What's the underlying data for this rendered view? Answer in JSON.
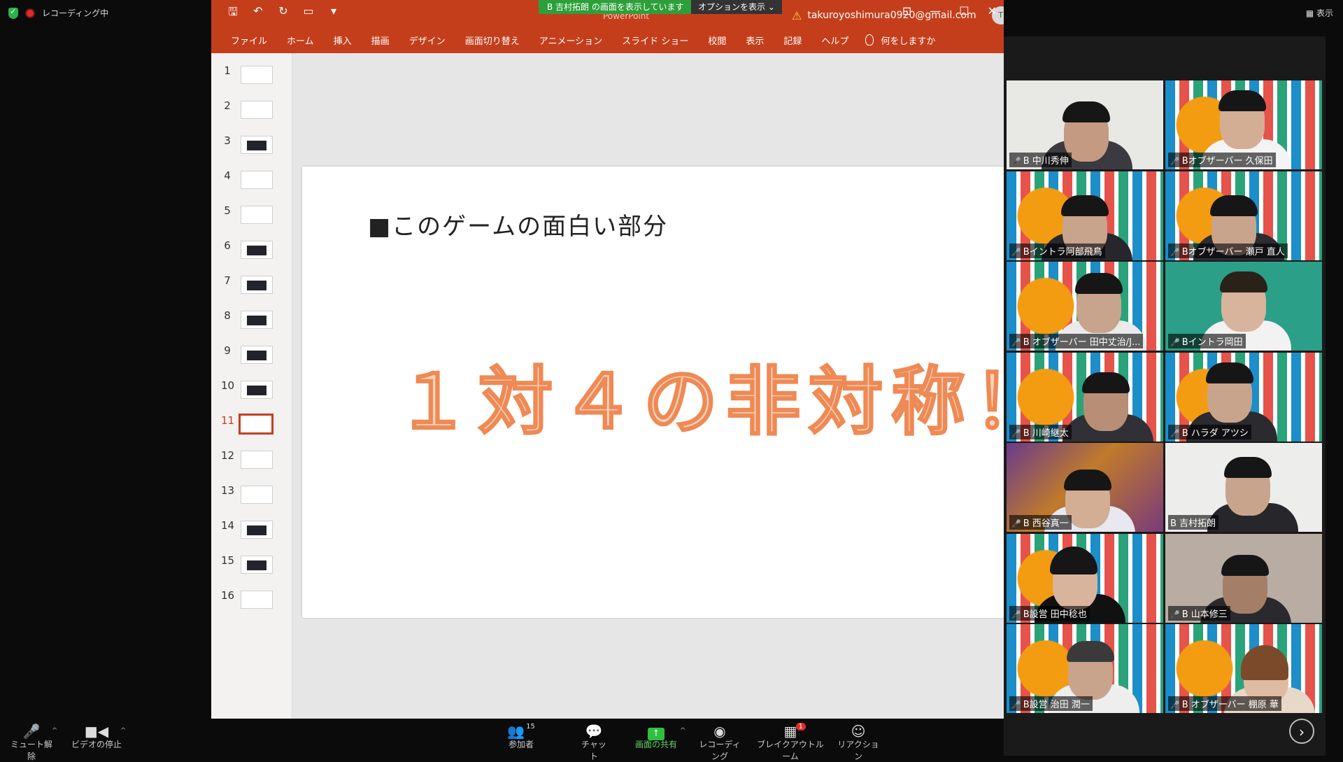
{
  "zoom": {
    "recording_status": "レコーディング中",
    "view_label": "表示",
    "share_banner": "B 吉村拓朗 の画面を表示しています",
    "options_label": "オプションを表示 ⌄"
  },
  "ppt": {
    "title_doc": "PowerPoint",
    "account": "takuroyoshimura0920@gmail.com",
    "avatar_letter": "T",
    "ribbon_tabs": [
      "ファイル",
      "ホーム",
      "挿入",
      "描画",
      "デザイン",
      "画面切り替え",
      "アニメーション",
      "スライド ショー",
      "校閲",
      "表示",
      "記録",
      "ヘルプ"
    ],
    "tell_me": "何をしますか",
    "slide_numbers": [
      "1",
      "2",
      "3",
      "4",
      "5",
      "6",
      "7",
      "8",
      "9",
      "10",
      "11",
      "12",
      "13",
      "14",
      "15",
      "16"
    ],
    "active_slide": 11,
    "slide": {
      "title": "■このゲームの面白い部分",
      "big_text": "１対４の非対称！"
    }
  },
  "participants": [
    {
      "name": "B 中川秀伸"
    },
    {
      "name": "Bオブザーバー 久保田"
    },
    {
      "name": "Bイントラ阿部飛鳥"
    },
    {
      "name": "Bオブザーバー 瀬戸 直人"
    },
    {
      "name": "B オブザーバー 田中丈治/J..."
    },
    {
      "name": "Bイントラ岡田"
    },
    {
      "name": "B 川崎継太"
    },
    {
      "name": "B ハラダ アツシ"
    },
    {
      "name": "B 西谷真一"
    },
    {
      "name": "B 吉村拓朗"
    },
    {
      "name": "B設営 田中稔也"
    },
    {
      "name": "B 山本修三"
    },
    {
      "name": "B設営 治田 潤一"
    },
    {
      "name": "B オブザーバー 棚原 華"
    }
  ],
  "toolbar": {
    "mute": "ミュート解除",
    "video": "ビデオの停止",
    "participants": "参加者",
    "participants_count": "15",
    "chat": "チャット",
    "share": "画面の共有",
    "record": "レコーディング",
    "breakout": "ブレイクアウトルーム",
    "breakout_badge": "1",
    "reaction": "リアクション"
  }
}
